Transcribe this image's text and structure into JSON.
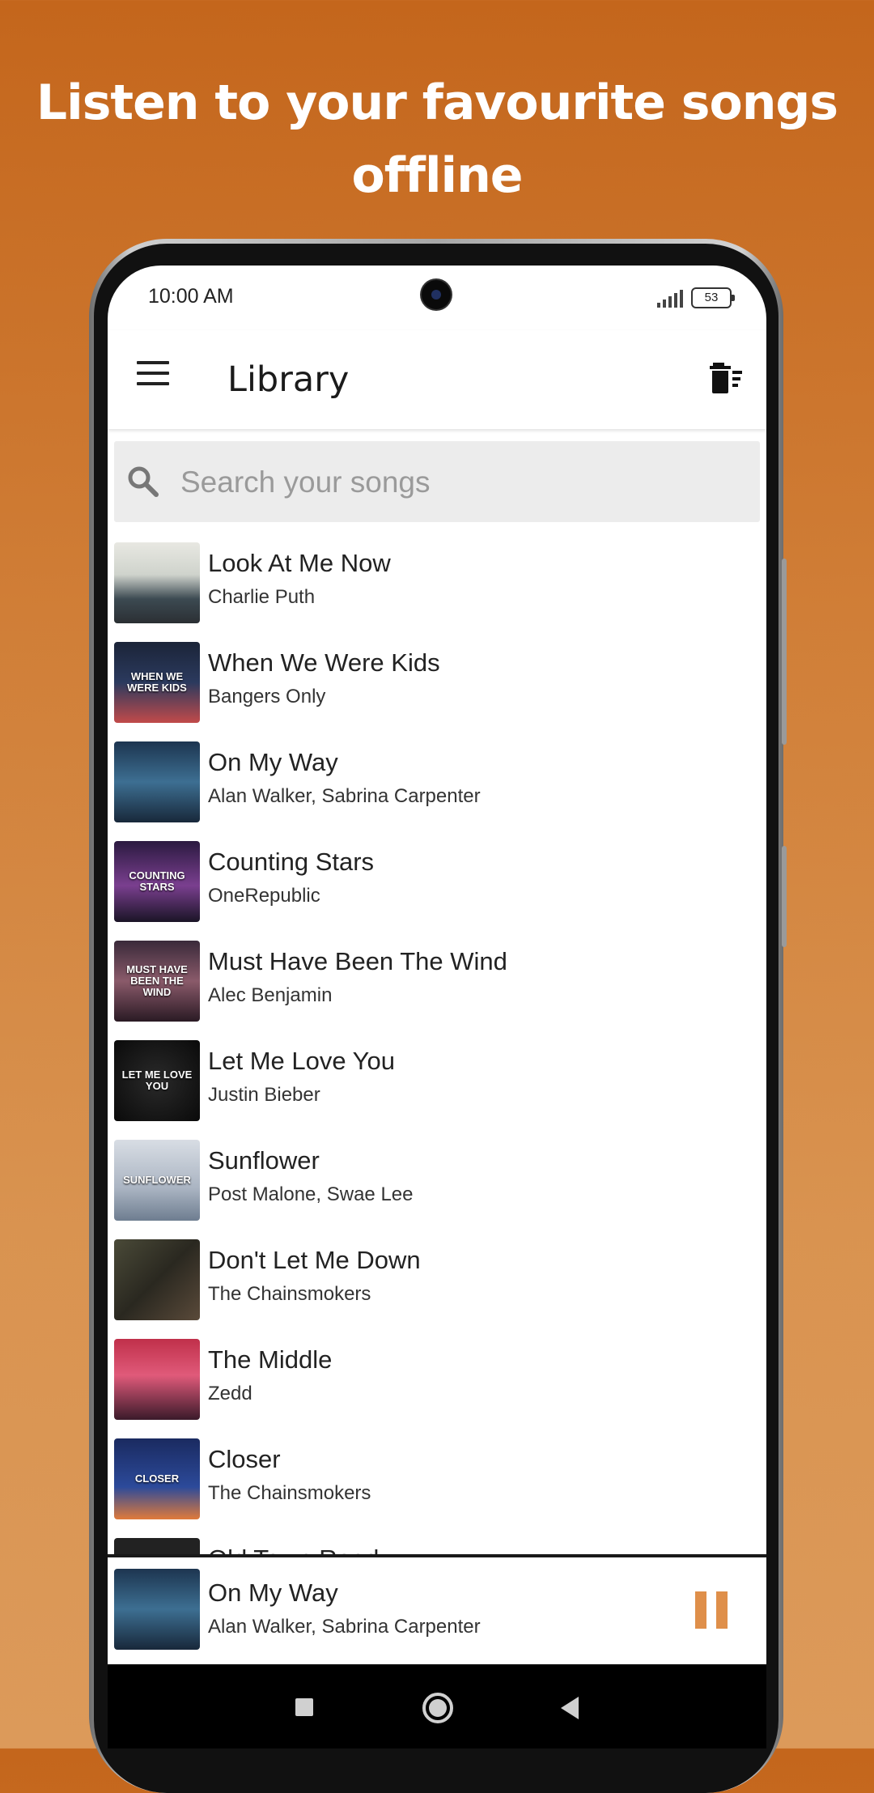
{
  "headline": "Listen to your favourite songs offline",
  "status_bar": {
    "time": "10:00 AM",
    "battery": "53"
  },
  "toolbar": {
    "title": "Library",
    "menu_icon": "hamburger-menu-icon",
    "action_icon": "delete-sweep-icon"
  },
  "search": {
    "placeholder": "Search your songs",
    "icon": "search-icon"
  },
  "songs": [
    {
      "title": "Look At Me Now",
      "artist": "Charlie Puth",
      "thumb_text": "",
      "thumb_bg": "linear-gradient(180deg,#e8e8e2 0%,#cfd3cc 40%,#3c4a52 70%,#2b2f33 100%)"
    },
    {
      "title": "When We Were Kids",
      "artist": "Bangers Only",
      "thumb_text": "WHEN WE WERE KIDS",
      "thumb_bg": "linear-gradient(180deg,#1b2438 0%,#2b3a5e 50%,#c24a4a 100%)"
    },
    {
      "title": "On My Way",
      "artist": "Alan Walker, Sabrina Carpenter",
      "thumb_text": "",
      "thumb_bg": "linear-gradient(180deg,#1d3550 0%,#3d6f92 50%,#18283a 100%)"
    },
    {
      "title": "Counting Stars",
      "artist": "OneRepublic",
      "thumb_text": "COUNTING STARS",
      "thumb_bg": "linear-gradient(180deg,#2b1a40 0%,#7a3f8f 55%,#1a1426 100%)"
    },
    {
      "title": "Must Have Been The Wind",
      "artist": "Alec Benjamin",
      "thumb_text": "MUST HAVE BEEN THE WIND",
      "thumb_bg": "linear-gradient(180deg,#3a2a3a 0%,#8a5a6a 50%,#2a1a24 100%)"
    },
    {
      "title": "Let Me Love You",
      "artist": "Justin Bieber",
      "thumb_text": "LET ME LOVE YOU",
      "thumb_bg": "radial-gradient(circle,#2a2a2a 0%,#0a0a0a 100%)"
    },
    {
      "title": "Sunflower",
      "artist": "Post Malone, Swae Lee",
      "thumb_text": "SUNFLOWER",
      "thumb_bg": "linear-gradient(180deg,#d8dde4 0%,#aab4c2 60%,#6e7d90 100%)"
    },
    {
      "title": "Don't Let Me Down",
      "artist": "The Chainsmokers",
      "thumb_text": "",
      "thumb_bg": "linear-gradient(135deg,#4a4a38 0%,#2a2820 50%,#5a4a3a 100%)"
    },
    {
      "title": "The Middle",
      "artist": "Zedd",
      "thumb_text": "",
      "thumb_bg": "linear-gradient(180deg,#c0304a 0%,#e05a7a 45%,#3a1a2a 100%)"
    },
    {
      "title": "Closer",
      "artist": "The Chainsmokers",
      "thumb_text": "CLOSER",
      "thumb_bg": "linear-gradient(180deg,#1a2a60 0%,#2c4a9a 60%,#e07a3a 100%)"
    },
    {
      "title": "Old Town Road",
      "artist": "",
      "thumb_text": "",
      "thumb_bg": "#222"
    }
  ],
  "now_playing": {
    "title": "On My Way",
    "artist": "Alan Walker, Sabrina Carpenter",
    "thumb_bg": "linear-gradient(180deg,#1d3550 0%,#3d6f92 50%,#18283a 100%)",
    "control_icon": "pause-icon",
    "accent": "#df8f4a"
  },
  "nav_bar": {
    "recents": "square-recents-icon",
    "home": "circle-home-icon",
    "back": "triangle-back-icon"
  }
}
